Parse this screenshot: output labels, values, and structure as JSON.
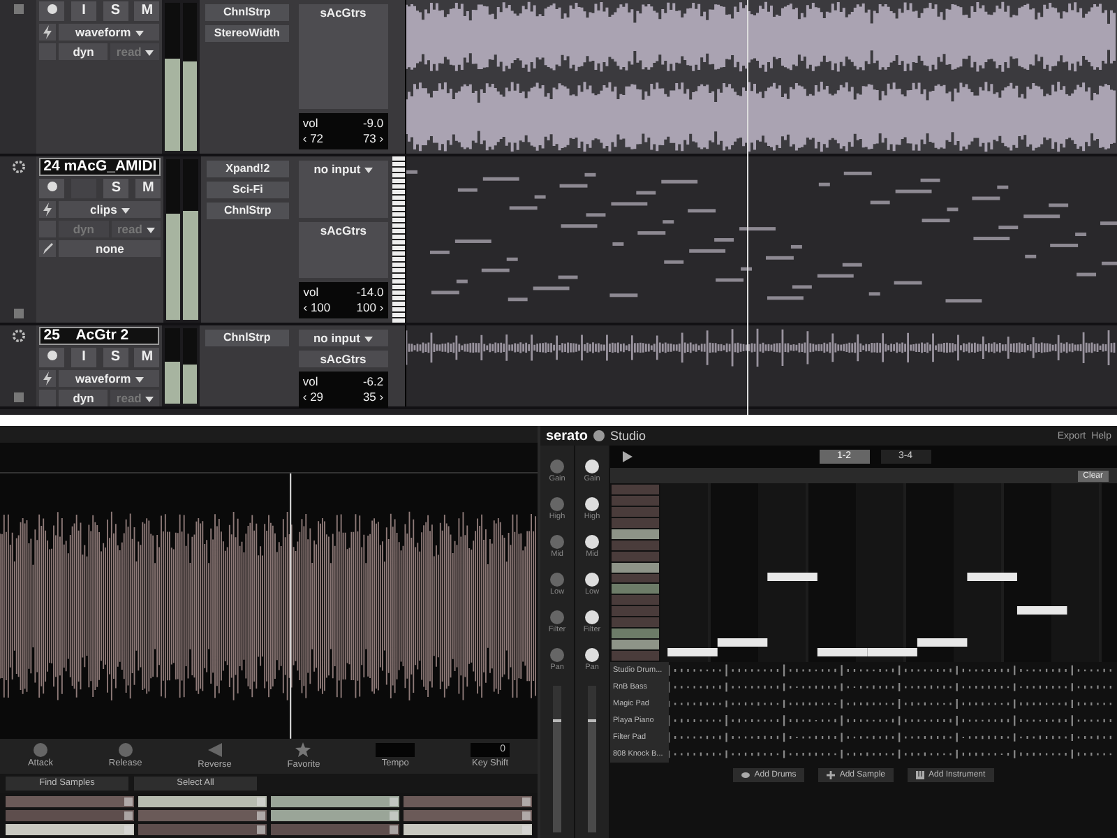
{
  "pro_tools": {
    "tracks": [
      {
        "kind": "audio",
        "buttons": [
          {
            "kind": "label",
            "label": "I"
          },
          {
            "kind": "label",
            "label": "S"
          },
          {
            "kind": "label",
            "label": "M"
          }
        ],
        "view": "waveform",
        "automation": "dyn",
        "automation_disabled": false,
        "mode": "read",
        "inserts": [
          "ChnlStrp",
          "StereoWidth"
        ],
        "output": "sAcGtrs",
        "vol_label": "vol",
        "vol": "-9.0",
        "pan_left": "‹ 72",
        "pan_right": "73 ›",
        "meters": [
          {
            "level": 0.62
          },
          {
            "level": 0.6
          }
        ]
      },
      {
        "name": "24 mAcG_AMIDI",
        "kind": "midi",
        "buttons": [
          {
            "kind": "empty"
          },
          {
            "kind": "label",
            "label": "S"
          },
          {
            "kind": "label",
            "label": "M"
          }
        ],
        "view": "clips",
        "automation": "dyn",
        "automation_disabled": true,
        "mode": "read",
        "extra": "none",
        "inserts": [
          "Xpand!2",
          "Sci-Fi",
          "ChnlStrp"
        ],
        "input": "no input",
        "output": "sAcGtrs",
        "vol_label": "vol",
        "vol": "-14.0",
        "pan_left": "‹ 100",
        "pan_right": "100 ›",
        "meters": [
          {
            "level": 0.66
          },
          {
            "level": 0.68
          }
        ]
      },
      {
        "name": "25    AcGtr 2",
        "kind": "audio",
        "buttons": [
          {
            "kind": "label",
            "label": "I"
          },
          {
            "kind": "label",
            "label": "S"
          },
          {
            "kind": "label",
            "label": "M"
          }
        ],
        "view": "waveform",
        "automation": "dyn",
        "automation_disabled": false,
        "mode": "read",
        "inserts": [
          "ChnlStrp"
        ],
        "input": "no input",
        "output": "sAcGtrs",
        "vol_label": "vol",
        "vol": "-6.2",
        "pan_left": "‹ 29",
        "pan_right": "35 ›",
        "meters": [
          {
            "level": 0.55
          },
          {
            "level": 0.52
          }
        ]
      }
    ]
  },
  "serato": {
    "deck": {
      "controls": [
        {
          "label": "Attack",
          "kind": "knob"
        },
        {
          "label": "Release",
          "kind": "knob"
        },
        {
          "label": "Reverse",
          "kind": "reverse"
        },
        {
          "label": "Favorite",
          "kind": "star"
        },
        {
          "label": "Tempo",
          "kind": "field"
        },
        {
          "label": "Key Shift",
          "kind": "field",
          "value": "0"
        }
      ],
      "find_samples": "Find Samples",
      "select_all": "Select All",
      "pads": [
        {
          "color": "#6b5a58"
        },
        {
          "color": "#b7bcb0"
        },
        {
          "color": "#9aa598"
        },
        {
          "color": "#6b5a58"
        },
        {
          "color": "#5e4e4d"
        },
        {
          "color": "#6a5a58"
        },
        {
          "color": "#9aa598"
        },
        {
          "color": "#6b5a58"
        },
        {
          "color": "#c8c8c0"
        },
        {
          "color": "#5e4e4d"
        },
        {
          "color": "#5e4e4d"
        },
        {
          "color": "#c8c8c0"
        }
      ]
    },
    "header": {
      "logo": "serato",
      "app": "Studio",
      "export": "Export",
      "help": "Help"
    },
    "mixer": [
      {
        "active": false,
        "level": 0.75,
        "knobs": [
          "Gain",
          "High",
          "Mid",
          "Low",
          "Filter",
          "Pan"
        ]
      },
      {
        "active": true,
        "level": 0.75,
        "knobs": [
          "Gain",
          "High",
          "Mid",
          "Low",
          "Filter",
          "Pan"
        ]
      }
    ],
    "sequencer": {
      "patterns": [
        {
          "label": "1-2",
          "selected": true
        },
        {
          "label": "3-4",
          "selected": false
        }
      ],
      "clear": "Clear",
      "keys": [
        {
          "color": "#4a3c3b"
        },
        {
          "color": "#4a3c3b"
        },
        {
          "color": "#4a3c3b"
        },
        {
          "color": "#4a3c3b"
        },
        {
          "color": "#8e9488"
        },
        {
          "color": "#4a3c3b"
        },
        {
          "color": "#4a3c3b"
        },
        {
          "color": "#8e9488"
        },
        {
          "color": "#4a3c3b"
        },
        {
          "color": "#6d7c68"
        },
        {
          "color": "#4a3c3b"
        },
        {
          "color": "#4a3c3b"
        },
        {
          "color": "#4a3c3b"
        },
        {
          "color": "#6d7c68"
        },
        {
          "color": "#8e9488"
        },
        {
          "color": "#4a3c3b"
        }
      ],
      "tracks": [
        {
          "name": "Studio Drum..."
        },
        {
          "name": "RnB Bass"
        },
        {
          "name": "Magic Pad"
        },
        {
          "name": "Playa Piano"
        },
        {
          "name": "Filter Pad"
        },
        {
          "name": "808 Knock B..."
        }
      ],
      "add_buttons": [
        {
          "label": "Add Drums",
          "kind": "drums"
        },
        {
          "label": "Add Sample",
          "kind": "sample"
        },
        {
          "label": "Add Instrument",
          "kind": "instrument"
        }
      ]
    }
  }
}
